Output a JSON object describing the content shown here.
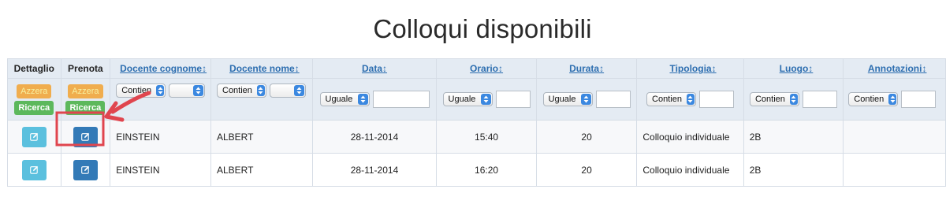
{
  "page": {
    "title": "Colloqui disponibili"
  },
  "colors": {
    "header_bg": "#e4ebf3",
    "link_blue": "#2d6eb0",
    "reset_orange": "#f0ad4e",
    "search_green": "#5cb85c",
    "detail_button": "#5bc0de",
    "book_button": "#337ab7",
    "annotation_red": "#e0454e"
  },
  "table": {
    "headers": {
      "dettaglio": "Dettaglio",
      "prenota": "Prenota",
      "docente_cognome": "Docente cognome↕",
      "docente_nome": "Docente nome↕",
      "data": "Data↕",
      "orario": "Orario↕",
      "durata": "Durata↕",
      "tipologia": "Tipologia↕",
      "luogo": "Luogo↕",
      "annotazioni": "Annotazioni↕"
    },
    "filters": {
      "reset_label": "Azzera",
      "search_label": "Ricerca",
      "op_contains": "Contien",
      "op_equals": "Uguale"
    },
    "rows": [
      {
        "cognome": "EINSTEIN",
        "nome": "ALBERT",
        "data": "28-11-2014",
        "orario": "15:40",
        "durata": "20",
        "tipologia": "Colloquio individuale",
        "luogo": "2B",
        "annotazioni": ""
      },
      {
        "cognome": "EINSTEIN",
        "nome": "ALBERT",
        "data": "28-11-2014",
        "orario": "16:20",
        "durata": "20",
        "tipologia": "Colloquio individuale",
        "luogo": "2B",
        "annotazioni": ""
      }
    ]
  },
  "icons": {
    "edit": "edit-icon",
    "select_arrows": "updown-arrows-icon",
    "annotation_arrow": "red-arrow-icon"
  }
}
